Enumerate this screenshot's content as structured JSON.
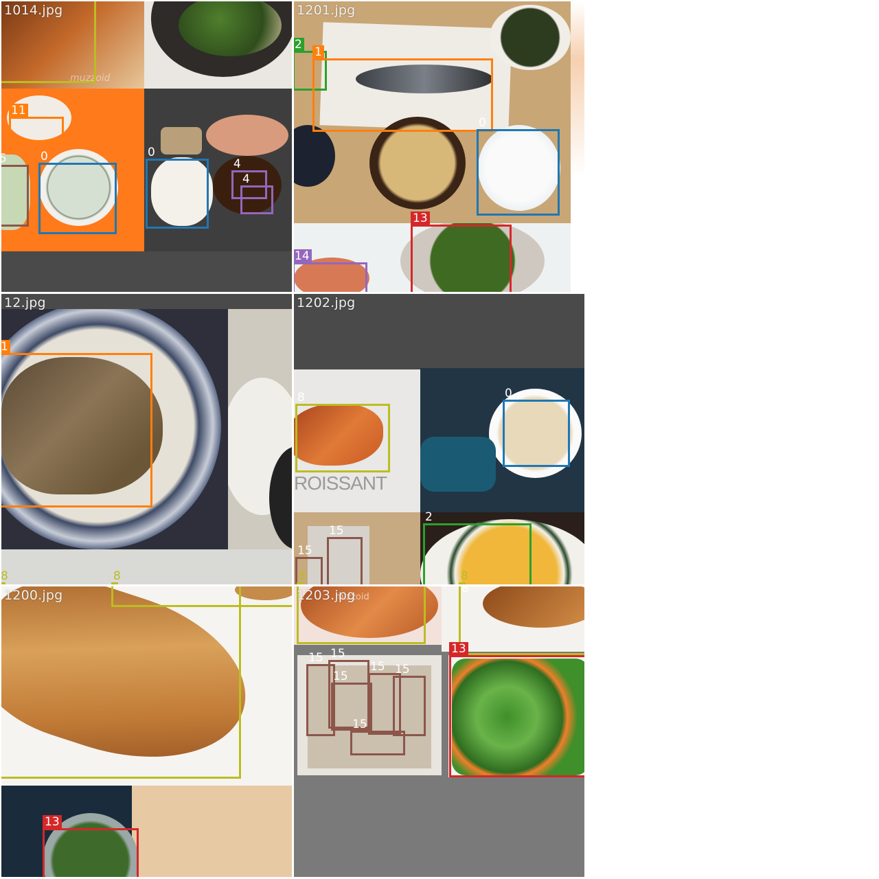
{
  "mosaic": {
    "tiles": [
      {
        "filename": "1014.jpg"
      },
      {
        "filename": "1201.jpg"
      },
      {
        "filename": "12.jpg"
      },
      {
        "filename": "1202.jpg"
      },
      {
        "filename": "1200.jpg"
      },
      {
        "filename": "1203.jpg"
      }
    ],
    "class_colors": {
      "0": "#1f77b4",
      "1": "#ff7f0e",
      "2": "#2ca02c",
      "4": "#9467bd",
      "5": "#8c564b",
      "8": "#bcbd22",
      "11": "#ff7f0e",
      "13": "#d62728",
      "14": "#9467bd",
      "15": "#8c564b"
    },
    "photo_texts": {
      "croissant_caption": "ROISSANT",
      "mizzo_mark": "mizzoid",
      "watermark_1014": "muzzoid"
    }
  }
}
